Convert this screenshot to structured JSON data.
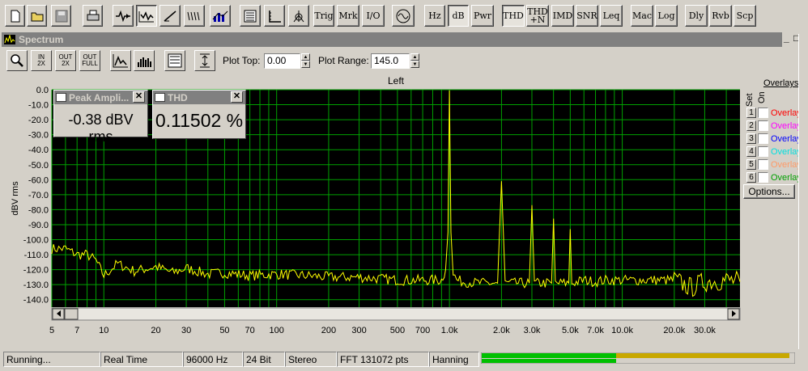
{
  "toolbar": {
    "buttons": [
      {
        "id": "new",
        "icon": "new-file-icon"
      },
      {
        "id": "open",
        "icon": "open-folder-icon"
      },
      {
        "id": "save",
        "icon": "save-disk-icon"
      },
      {
        "id": "print",
        "icon": "printer-icon"
      },
      {
        "id": "generator",
        "icon": "generator-icon"
      },
      {
        "id": "spectrum",
        "icon": "spectrum-icon"
      },
      {
        "id": "sweep",
        "icon": "sweep-icon"
      },
      {
        "id": "waterfall",
        "icon": "waterfall-icon"
      },
      {
        "id": "eq",
        "icon": "equalizer-icon"
      },
      {
        "id": "meter",
        "icon": "meter-icon"
      },
      {
        "id": "scope",
        "icon": "scope-axis-icon"
      },
      {
        "id": "phase",
        "icon": "phase-icon"
      }
    ],
    "labels": {
      "trig": "Trig",
      "mrk": "Mrk",
      "io": "I/O",
      "hz": "Hz",
      "db": "dB",
      "pwr": "Pwr",
      "thd": "THD",
      "thdn_top": "THD",
      "thdn_bottom": "+N",
      "imd": "IMD",
      "snr": "SNR",
      "leq": "Leq",
      "mac": "Mac",
      "log": "Log",
      "dly": "Dly",
      "rvb": "Rvb",
      "scp": "Scp"
    }
  },
  "window": {
    "title": "Spectrum",
    "controls": {
      "minimize": "_",
      "restore": "□"
    }
  },
  "spectrum_toolbar": {
    "zoom_in_top": "IN",
    "zoom_in_bottom": "2X",
    "zoom_out_top": "OUT",
    "zoom_out_bottom": "2X",
    "zoom_full_top": "OUT",
    "zoom_full_bottom": "FULL",
    "plot_top_label": "Plot Top:",
    "plot_top_value": "0.00",
    "plot_range_label": "Plot Range:",
    "plot_range_value": "145.0"
  },
  "readouts": [
    {
      "title": "Peak Ampli...",
      "value": "-0.38 dBV rms"
    },
    {
      "title": "THD",
      "value": "0.11502 %"
    }
  ],
  "overlays": {
    "header": "Overlays",
    "set_label": "Set",
    "on_label": "On",
    "items": [
      {
        "num": "1",
        "label": "Overlay",
        "color": "#ff0000"
      },
      {
        "num": "2",
        "label": "Overlay",
        "color": "#ff00ff"
      },
      {
        "num": "3",
        "label": "Overlay",
        "color": "#0000ff"
      },
      {
        "num": "4",
        "label": "Overlay",
        "color": "#00e0e0"
      },
      {
        "num": "5",
        "label": "Overlay",
        "color": "#ff9966"
      },
      {
        "num": "6",
        "label": "Overlay",
        "color": "#00a000"
      }
    ],
    "options_label": "Options..."
  },
  "chart_data": {
    "type": "line",
    "title": "Left",
    "xlabel": "",
    "ylabel": "dBV rms",
    "x_scale": "log",
    "xlim": [
      5,
      48000
    ],
    "ylim": [
      -145,
      0
    ],
    "grid": true,
    "background": "#000000",
    "grid_color": "#00a000",
    "trace_color": "#ffff00",
    "x_tick_labels": [
      "5",
      "7",
      "10",
      "20",
      "30",
      "50",
      "70",
      "100",
      "200",
      "300",
      "500",
      "700",
      "1.0k",
      "2.0k",
      "3.0k",
      "5.0k",
      "7.0k",
      "10.0k",
      "20.0k",
      "30.0k"
    ],
    "x_tick_values": [
      5,
      7,
      10,
      20,
      30,
      50,
      70,
      100,
      200,
      300,
      500,
      700,
      1000,
      2000,
      3000,
      5000,
      7000,
      10000,
      20000,
      30000
    ],
    "y_tick_labels": [
      "0.0",
      "-10.0",
      "-20.0",
      "-30.0",
      "-40.0",
      "-50.0",
      "-60.0",
      "-70.0",
      "-80.0",
      "-90.0",
      "-100.0",
      "-110.0",
      "-120.0",
      "-130.0",
      "-140.0"
    ],
    "y_tick_values": [
      0,
      -10,
      -20,
      -30,
      -40,
      -50,
      -60,
      -70,
      -80,
      -90,
      -100,
      -110,
      -120,
      -130,
      -140
    ],
    "series": [
      {
        "x": [
          5,
          6,
          7,
          8,
          9,
          10,
          12,
          15,
          20,
          25,
          30,
          40,
          50,
          70,
          100,
          150,
          200,
          300,
          500,
          700,
          900,
          950,
          980,
          1000,
          1020,
          1050,
          1100,
          1200,
          1500,
          1900,
          2000,
          2100,
          2500,
          2900,
          3000,
          3100,
          3500,
          3900,
          4000,
          4100,
          4500,
          4900,
          5000,
          5100,
          6000,
          7000,
          8000,
          10000,
          15000,
          20000,
          25000,
          30000,
          40000,
          48000
        ],
        "y": [
          -106,
          -106,
          -110,
          -110,
          -114,
          -124,
          -116,
          -121,
          -118,
          -122,
          -119,
          -123,
          -122,
          -124,
          -123,
          -124,
          -125,
          -125,
          -127,
          -127,
          -127,
          -120,
          -95,
          -0.4,
          -95,
          -122,
          -127,
          -128,
          -129,
          -129,
          -61,
          -129,
          -129,
          -129,
          -77,
          -129,
          -129,
          -129,
          -86,
          -129,
          -129,
          -129,
          -93,
          -129,
          -127,
          -128,
          -127,
          -127,
          -127,
          -127,
          -132,
          -128,
          -127,
          -128
        ]
      }
    ]
  },
  "statusbar": {
    "status": "Running...",
    "mode": "Real Time",
    "rate": "96000 Hz",
    "bits": "24 Bit",
    "channels": "Stereo",
    "fft": "FFT 131072 pts",
    "window": "Hanning",
    "level_top": 0.985,
    "level_bottom": 0.43
  }
}
